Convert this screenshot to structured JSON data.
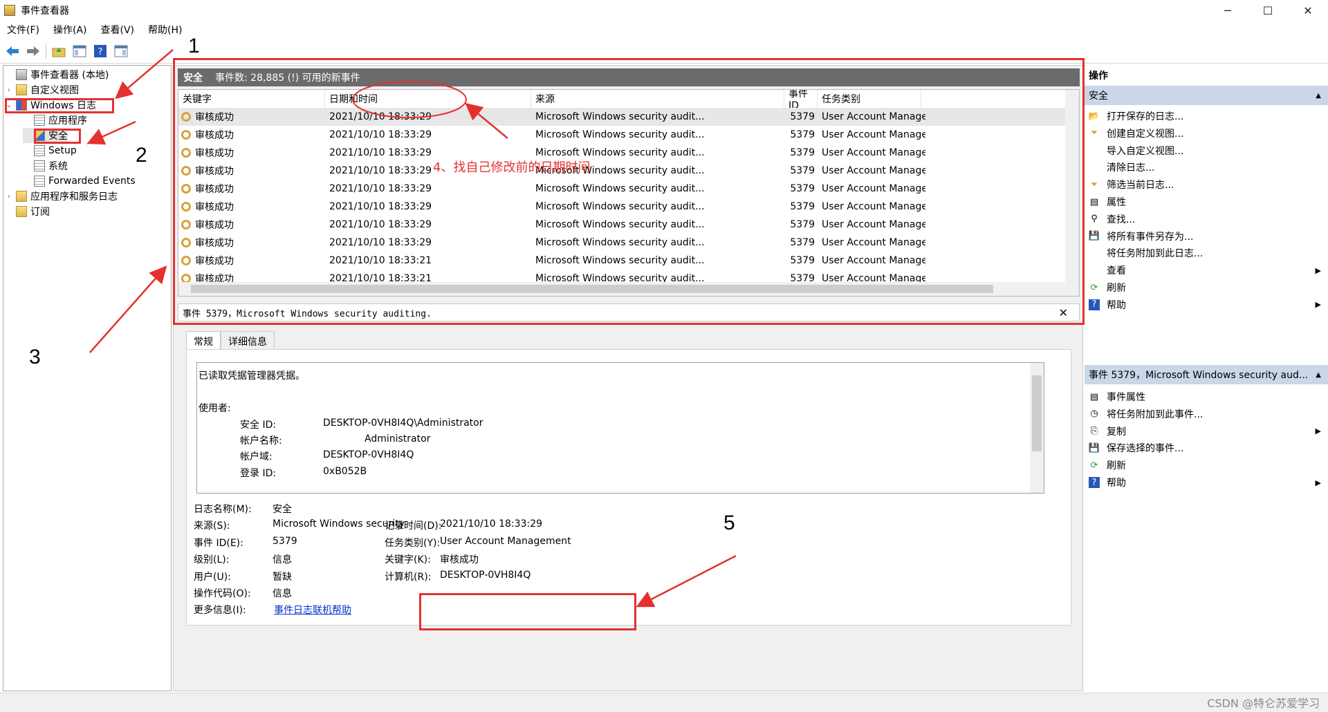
{
  "window": {
    "title": "事件查看器",
    "minimize": "─",
    "maximize": "☐",
    "close": "✕"
  },
  "menu": [
    "文件(F)",
    "操作(A)",
    "查看(V)",
    "帮助(H)"
  ],
  "toolbar": {
    "icons": [
      "back-arrow-icon",
      "forward-arrow-icon",
      "up-folder-icon",
      "show-hide-tree-icon",
      "help-icon",
      "show-hide-action-pane-icon"
    ]
  },
  "tree": {
    "root": "事件查看器 (本地)",
    "custom_views": "自定义视图",
    "windows_logs": "Windows 日志",
    "application": "应用程序",
    "security": "安全",
    "setup": "Setup",
    "system": "系统",
    "forwarded": "Forwarded Events",
    "apps_services": "应用程序和服务日志",
    "subscriptions": "订阅"
  },
  "center": {
    "header_title": "安全",
    "header_info": "事件数: 28,885 (!) 可用的新事件",
    "columns": [
      "关键字",
      "日期和时间",
      "来源",
      "事件 ID",
      "任务类别"
    ],
    "rows": [
      {
        "keyword": "审核成功",
        "datetime": "2021/10/10 18:33:29",
        "source": "Microsoft Windows security audit...",
        "event_id": "5379",
        "task": "User Account Manage"
      },
      {
        "keyword": "审核成功",
        "datetime": "2021/10/10 18:33:29",
        "source": "Microsoft Windows security audit...",
        "event_id": "5379",
        "task": "User Account Manage"
      },
      {
        "keyword": "审核成功",
        "datetime": "2021/10/10 18:33:29",
        "source": "Microsoft Windows security audit...",
        "event_id": "5379",
        "task": "User Account Manage"
      },
      {
        "keyword": "审核成功",
        "datetime": "2021/10/10 18:33:29",
        "source": "Microsoft Windows security audit...",
        "event_id": "5379",
        "task": "User Account Manage"
      },
      {
        "keyword": "审核成功",
        "datetime": "2021/10/10 18:33:29",
        "source": "Microsoft Windows security audit...",
        "event_id": "5379",
        "task": "User Account Manage"
      },
      {
        "keyword": "审核成功",
        "datetime": "2021/10/10 18:33:29",
        "source": "Microsoft Windows security audit...",
        "event_id": "5379",
        "task": "User Account Manage"
      },
      {
        "keyword": "审核成功",
        "datetime": "2021/10/10 18:33:29",
        "source": "Microsoft Windows security audit...",
        "event_id": "5379",
        "task": "User Account Manage"
      },
      {
        "keyword": "审核成功",
        "datetime": "2021/10/10 18:33:29",
        "source": "Microsoft Windows security audit...",
        "event_id": "5379",
        "task": "User Account Manage"
      },
      {
        "keyword": "审核成功",
        "datetime": "2021/10/10 18:33:21",
        "source": "Microsoft Windows security audit...",
        "event_id": "5379",
        "task": "User Account Manage"
      },
      {
        "keyword": "审核成功",
        "datetime": "2021/10/10 18:33:21",
        "source": "Microsoft Windows security audit...",
        "event_id": "5379",
        "task": "User Account Manage"
      }
    ],
    "event_bar": "事件 5379，Microsoft Windows security auditing.",
    "event_bar_close": "✕",
    "tabs": [
      "常规",
      "详细信息"
    ],
    "description": {
      "line1": "已读取凭据管理器凭据。",
      "user_label": "使用者:",
      "sid_label": "安全 ID:",
      "sid_value": "DESKTOP-0VH8I4Q\\Administrator",
      "account_label": "帐户名称:",
      "account_value": "Administrator",
      "domain_label": "帐户域:",
      "domain_value": "DESKTOP-0VH8I4Q",
      "logon_label": "登录 ID:",
      "logon_value": "0xB052B"
    },
    "props": {
      "log_name_label": "日志名称(M):",
      "log_name": "安全",
      "source_label": "来源(S):",
      "source": "Microsoft Windows security",
      "logged_label": "记录时间(D):",
      "logged": "2021/10/10 18:33:29",
      "event_id_label": "事件 ID(E):",
      "event_id": "5379",
      "task_label": "任务类别(Y):",
      "task": "User Account Management",
      "level_label": "级别(L):",
      "level": "信息",
      "keywords_label": "关键字(K):",
      "keywords": "审核成功",
      "user_label": "用户(U):",
      "user": "暂缺",
      "computer_label": "计算机(R):",
      "computer": "DESKTOP-0VH8I4Q",
      "opcode_label": "操作代码(O):",
      "opcode": "信息",
      "more_label": "更多信息(I):",
      "more_link": "事件日志联机帮助"
    }
  },
  "actions": {
    "title": "操作",
    "section1": "安全",
    "items1": [
      {
        "icon": "open-log-icon",
        "label": "打开保存的日志..."
      },
      {
        "icon": "filter-icon",
        "label": "创建自定义视图..."
      },
      {
        "icon": "",
        "label": "导入自定义视图..."
      },
      {
        "icon": "",
        "label": "清除日志..."
      },
      {
        "icon": "filter-icon",
        "label": "筛选当前日志..."
      },
      {
        "icon": "properties-icon",
        "label": "属性"
      },
      {
        "icon": "find-icon",
        "label": "查找..."
      },
      {
        "icon": "save-icon",
        "label": "将所有事件另存为..."
      },
      {
        "icon": "",
        "label": "将任务附加到此日志..."
      },
      {
        "icon": "",
        "label": "查看"
      },
      {
        "icon": "refresh-icon",
        "label": "刷新"
      },
      {
        "icon": "help-icon",
        "label": "帮助"
      }
    ],
    "section2": "事件 5379，Microsoft Windows security aud...",
    "items2": [
      {
        "icon": "event-properties-icon",
        "label": "事件属性"
      },
      {
        "icon": "attach-task-icon",
        "label": "将任务附加到此事件..."
      },
      {
        "icon": "copy-icon",
        "label": "复制"
      },
      {
        "icon": "save-icon",
        "label": "保存选择的事件..."
      },
      {
        "icon": "refresh-icon",
        "label": "刷新"
      },
      {
        "icon": "help-icon",
        "label": "帮助"
      }
    ]
  },
  "annotations": {
    "n1": "1",
    "n2": "2",
    "n3": "3",
    "n4": "4",
    "n5": "5",
    "note4": "4、找自己修改前的日期时间",
    "color": "#e53030"
  },
  "watermark": "CSDN @特仑苏爱学习"
}
